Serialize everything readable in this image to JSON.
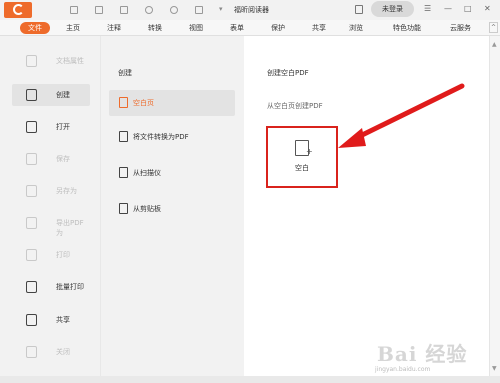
{
  "titlebar": {
    "app_title": "福昕阅读器",
    "login_label": "未登录",
    "qa_dropdown": "▾",
    "controls": {
      "menu": "☰",
      "minimize": "—",
      "maximize": "□",
      "close": "✕"
    }
  },
  "menubar": {
    "items": [
      "文件",
      "主页",
      "注释",
      "转换",
      "视图",
      "表单",
      "保护",
      "共享",
      "浏览",
      "特色功能",
      "云服务"
    ],
    "collapse": "^"
  },
  "leftnav": {
    "items": [
      {
        "label": "文档属性",
        "icon": "document-properties-icon",
        "enabled": false
      },
      {
        "label": "创建",
        "icon": "create-icon",
        "enabled": true,
        "active": true
      },
      {
        "label": "打开",
        "icon": "open-folder-icon",
        "enabled": true
      },
      {
        "label": "保存",
        "icon": "save-icon",
        "enabled": false
      },
      {
        "label": "另存为",
        "icon": "save-as-icon",
        "enabled": false
      },
      {
        "label": "导出PDF为",
        "icon": "export-pdf-icon",
        "enabled": false
      },
      {
        "label": "打印",
        "icon": "print-icon",
        "enabled": false
      },
      {
        "label": "批量打印",
        "icon": "batch-print-icon",
        "enabled": true
      },
      {
        "label": "共享",
        "icon": "share-icon",
        "enabled": true
      },
      {
        "label": "关闭",
        "icon": "close-doc-icon",
        "enabled": false
      }
    ]
  },
  "midpanel": {
    "heading": "创建",
    "items": [
      {
        "label": "空白页",
        "icon": "blank-page-icon",
        "active": true
      },
      {
        "label": "将文件转换为PDF",
        "icon": "convert-file-icon"
      },
      {
        "label": "从扫描仪",
        "icon": "scanner-icon"
      },
      {
        "label": "从剪贴板",
        "icon": "clipboard-icon"
      }
    ]
  },
  "main": {
    "title": "创建空白PDF",
    "subtitle": "从空白页创建PDF",
    "card_label": "空白",
    "card_plus": "+"
  },
  "scrollbar": {
    "up": "▲",
    "down": "▼"
  },
  "watermark": {
    "text": "Bai 经验",
    "url": "jingyan.baidu.com"
  },
  "colors": {
    "accent": "#ee6b2b",
    "highlight_red": "#d9231c",
    "panel_bg": "#f2f2f2",
    "active_bg": "#e3e3e3"
  }
}
